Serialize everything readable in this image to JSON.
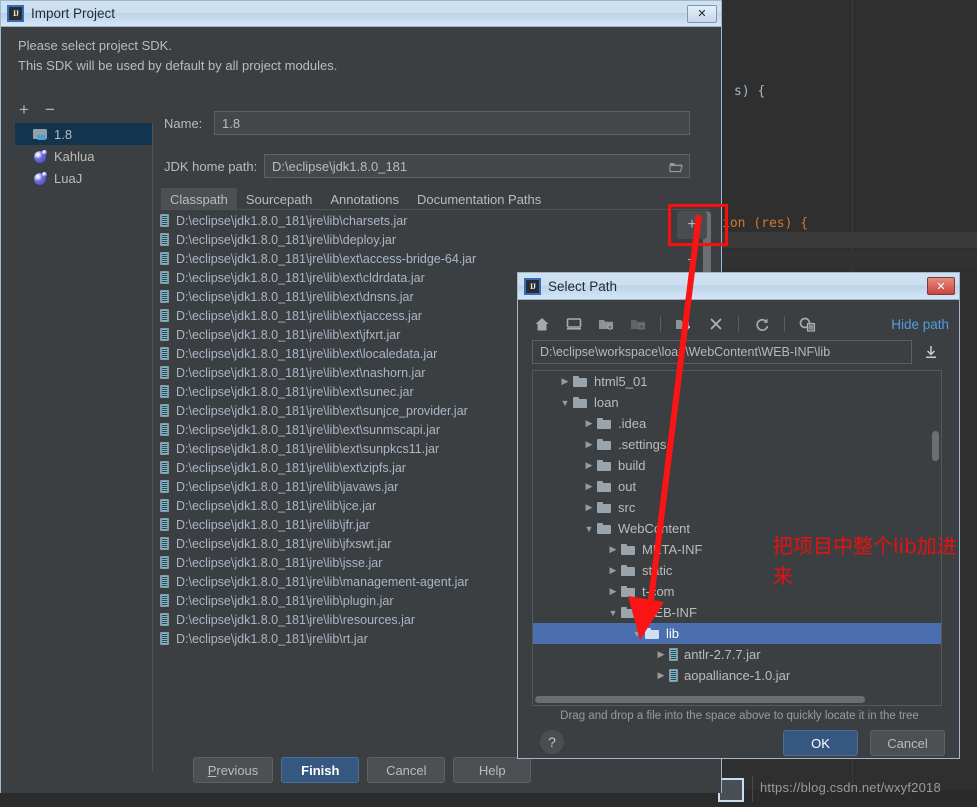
{
  "background": {
    "code_lines": [
      "s) {",
      "ion (res) {"
    ],
    "watermark": "https://blog.csdn.net/wxyf2018"
  },
  "import_dialog": {
    "title": "Import Project",
    "close_label": "✕",
    "prompt_line1": "Please select project SDK.",
    "prompt_line2": "This SDK will be used by default by all project modules.",
    "sdk_toolbar": {
      "add_label": "+",
      "remove_label": "−"
    },
    "sdk_items": [
      {
        "label": "1.8",
        "icon": "jdk-icon",
        "selected": true
      },
      {
        "label": "Kahlua",
        "icon": "lua-icon",
        "selected": false
      },
      {
        "label": "LuaJ",
        "icon": "lua-icon",
        "selected": false
      }
    ],
    "name_label": "Name:",
    "name_value": "1.8",
    "jdk_label": "JDK home path:",
    "jdk_value": "D:\\eclipse\\jdk1.8.0_181",
    "browse_icon": "folder-open-icon",
    "tabs": [
      {
        "label": "Classpath",
        "active": true
      },
      {
        "label": "Sourcepath",
        "active": false
      },
      {
        "label": "Annotations",
        "active": false
      },
      {
        "label": "Documentation Paths",
        "active": false
      }
    ],
    "classpath_entries": [
      "D:\\eclipse\\jdk1.8.0_181\\jre\\lib\\charsets.jar",
      "D:\\eclipse\\jdk1.8.0_181\\jre\\lib\\deploy.jar",
      "D:\\eclipse\\jdk1.8.0_181\\jre\\lib\\ext\\access-bridge-64.jar",
      "D:\\eclipse\\jdk1.8.0_181\\jre\\lib\\ext\\cldrdata.jar",
      "D:\\eclipse\\jdk1.8.0_181\\jre\\lib\\ext\\dnsns.jar",
      "D:\\eclipse\\jdk1.8.0_181\\jre\\lib\\ext\\jaccess.jar",
      "D:\\eclipse\\jdk1.8.0_181\\jre\\lib\\ext\\jfxrt.jar",
      "D:\\eclipse\\jdk1.8.0_181\\jre\\lib\\ext\\localedata.jar",
      "D:\\eclipse\\jdk1.8.0_181\\jre\\lib\\ext\\nashorn.jar",
      "D:\\eclipse\\jdk1.8.0_181\\jre\\lib\\ext\\sunec.jar",
      "D:\\eclipse\\jdk1.8.0_181\\jre\\lib\\ext\\sunjce_provider.jar",
      "D:\\eclipse\\jdk1.8.0_181\\jre\\lib\\ext\\sunmscapi.jar",
      "D:\\eclipse\\jdk1.8.0_181\\jre\\lib\\ext\\sunpkcs11.jar",
      "D:\\eclipse\\jdk1.8.0_181\\jre\\lib\\ext\\zipfs.jar",
      "D:\\eclipse\\jdk1.8.0_181\\jre\\lib\\javaws.jar",
      "D:\\eclipse\\jdk1.8.0_181\\jre\\lib\\jce.jar",
      "D:\\eclipse\\jdk1.8.0_181\\jre\\lib\\jfr.jar",
      "D:\\eclipse\\jdk1.8.0_181\\jre\\lib\\jfxswt.jar",
      "D:\\eclipse\\jdk1.8.0_181\\jre\\lib\\jsse.jar",
      "D:\\eclipse\\jdk1.8.0_181\\jre\\lib\\management-agent.jar",
      "D:\\eclipse\\jdk1.8.0_181\\jre\\lib\\plugin.jar",
      "D:\\eclipse\\jdk1.8.0_181\\jre\\lib\\resources.jar",
      "D:\\eclipse\\jdk1.8.0_181\\jre\\lib\\rt.jar"
    ],
    "side_buttons": {
      "add_label": "+",
      "remove_label": "−"
    },
    "footer_buttons": [
      {
        "label": "Previous",
        "primary": false,
        "mnemonic": "P"
      },
      {
        "label": "Finish",
        "primary": true
      },
      {
        "label": "Cancel",
        "primary": false
      },
      {
        "label": "Help",
        "primary": false
      }
    ]
  },
  "select_path_dialog": {
    "title": "Select Path",
    "close_label": "✕",
    "toolbar_icons": [
      "home-icon",
      "desktop-icon",
      "project-folder-icon",
      "module-folder-icon",
      "new-folder-icon",
      "delete-icon",
      "refresh-icon",
      "show-hidden-files-icon"
    ],
    "hide_path_label": "Hide path",
    "path_value": "D:\\eclipse\\workspace\\loan\\WebContent\\WEB-INF\\lib",
    "path_dropdown_icon": "download-arrow-icon",
    "tree": [
      {
        "label": "html5_01",
        "depth": 1,
        "twisty": "▶",
        "kind": "folder",
        "selected": false
      },
      {
        "label": "loan",
        "depth": 1,
        "twisty": "▼",
        "kind": "folder",
        "selected": false
      },
      {
        "label": ".idea",
        "depth": 2,
        "twisty": "▶",
        "kind": "folder",
        "selected": false
      },
      {
        "label": ".settings",
        "depth": 2,
        "twisty": "▶",
        "kind": "folder",
        "selected": false
      },
      {
        "label": "build",
        "depth": 2,
        "twisty": "▶",
        "kind": "folder",
        "selected": false
      },
      {
        "label": "out",
        "depth": 2,
        "twisty": "▶",
        "kind": "folder",
        "selected": false
      },
      {
        "label": "src",
        "depth": 2,
        "twisty": "▶",
        "kind": "folder",
        "selected": false
      },
      {
        "label": "WebContent",
        "depth": 2,
        "twisty": "▼",
        "kind": "folder",
        "selected": false
      },
      {
        "label": "META-INF",
        "depth": 3,
        "twisty": "▶",
        "kind": "folder",
        "selected": false
      },
      {
        "label": "static",
        "depth": 3,
        "twisty": "▶",
        "kind": "folder",
        "selected": false
      },
      {
        "label": "t-com",
        "depth": 3,
        "twisty": "▶",
        "kind": "folder",
        "selected": false
      },
      {
        "label": "WEB-INF",
        "depth": 3,
        "twisty": "▼",
        "kind": "folder",
        "selected": false
      },
      {
        "label": "lib",
        "depth": 4,
        "twisty": "▼",
        "kind": "folder",
        "selected": true
      },
      {
        "label": "antlr-2.7.7.jar",
        "depth": 5,
        "twisty": "▶",
        "kind": "jar",
        "selected": false
      },
      {
        "label": "aopalliance-1.0.jar",
        "depth": 5,
        "twisty": "▶",
        "kind": "jar",
        "selected": false
      }
    ],
    "hint": "Drag and drop a file into the space above to quickly locate it in the tree",
    "help_label": "?",
    "ok_label": "OK",
    "cancel_label": "Cancel"
  },
  "annotation": {
    "text": "把项目中整个lib加进来",
    "color": "#e81010"
  }
}
